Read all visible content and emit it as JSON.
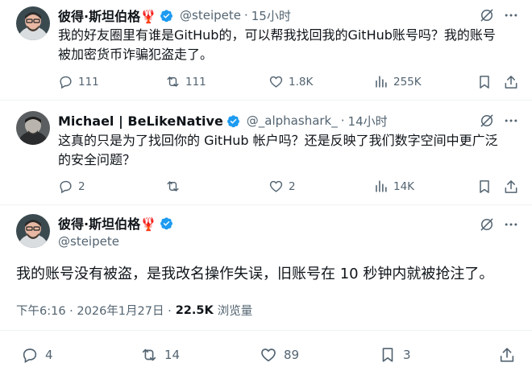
{
  "tweet1": {
    "display_name": "彼得·斯坦伯格🦞",
    "handle": "@steipete",
    "separator": "·",
    "time": "15小时",
    "text_line1": "我的好友圈里有谁是GitHub的，可以帮我找回我的GitHub账号吗？我的账号",
    "text_line2": "被加密货币诈骗犯盗走了。",
    "replies": "111",
    "reposts": "111",
    "likes": "1.8K",
    "views": "255K"
  },
  "tweet2": {
    "display_name": "Michael | BeLikeNative",
    "handle": "@_alphashark_",
    "separator": "·",
    "time": "14小时",
    "text_line1": "这真的只是为了找回你的 GitHub 帐户吗？还是反映了我们数字空间中更广泛",
    "text_line2": "的安全问题？",
    "replies": "2",
    "likes": "2",
    "views": "14K"
  },
  "main_tweet": {
    "display_name": "彼得·斯坦伯格🦞",
    "handle": "@steipete",
    "text": "我的账号没有被盗，是我改名操作失误，旧账号在 10 秒钟内就被抢注了。",
    "timestamp": "下午6:16 · 2026年1月27日 ·",
    "views_count": "22.5K",
    "views_label": "浏览量",
    "replies": "4",
    "reposts": "14",
    "likes": "89",
    "bookmarks": "3"
  },
  "colors": {
    "verified": "#1d9bf0",
    "text": "#0f1419",
    "muted": "#536471",
    "divider": "#eff3f4"
  }
}
